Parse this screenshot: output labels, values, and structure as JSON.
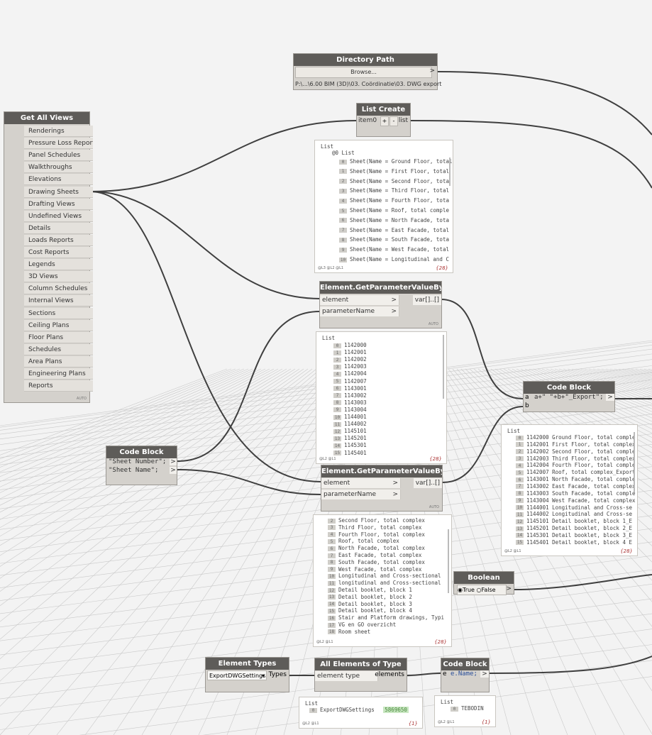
{
  "directory_path": {
    "title": "Directory Path",
    "browse_label": "Browse...",
    "path_value": "P:\\...\\6.00 BIM (3D)\\03. Coördinatie\\03. DWG export"
  },
  "get_all_views": {
    "title": "Get All Views",
    "auto": "AUTO",
    "items": [
      "Renderings",
      "Pressure Loss Reports",
      "Panel Schedules",
      "Walkthroughs",
      "Elevations",
      "Drawing Sheets",
      "Drafting Views",
      "Undefined Views",
      "Details",
      "Loads Reports",
      "Cost Reports",
      "Legends",
      "3D Views",
      "Column Schedules",
      "Internal Views",
      "Sections",
      "Ceiling Plans",
      "Floor Plans",
      "Schedules",
      "Area Plans",
      "Engineering Plans",
      "Reports"
    ]
  },
  "list_create": {
    "title": "List Create",
    "input_label": "item0",
    "plus": "+",
    "minus": "-",
    "output_label": "list",
    "preview": {
      "title": "List",
      "subtitle": "@0 List",
      "rows": [
        {
          "i": "0",
          "t": "Sheet(Name = Ground Floor, total"
        },
        {
          "i": "1",
          "t": "Sheet(Name = First Floor, total"
        },
        {
          "i": "2",
          "t": "Sheet(Name = Second Floor, tota"
        },
        {
          "i": "3",
          "t": "Sheet(Name = Third Floor, total"
        },
        {
          "i": "4",
          "t": "Sheet(Name = Fourth Floor, tota"
        },
        {
          "i": "5",
          "t": "Sheet(Name = Roof, total comple"
        },
        {
          "i": "6",
          "t": "Sheet(Name = North Facade, tota"
        },
        {
          "i": "7",
          "t": "Sheet(Name = East Facade, total"
        },
        {
          "i": "8",
          "t": "Sheet(Name = South Facade, tota"
        },
        {
          "i": "9",
          "t": "Sheet(Name = West Facade, total"
        },
        {
          "i": "10",
          "t": "Sheet(Name = Longitudinal and C"
        }
      ],
      "footer": "@L3 @L2 @L1",
      "count": "{28}"
    }
  },
  "get_param_1": {
    "title": "Element.GetParameterValueByName",
    "in1": "element",
    "in2": "parameterName",
    "out": "var[]..[]",
    "auto": "AUTO",
    "preview": {
      "title": "List",
      "rows": [
        {
          "i": "0",
          "t": "1142000"
        },
        {
          "i": "1",
          "t": "1142001"
        },
        {
          "i": "2",
          "t": "1142002"
        },
        {
          "i": "3",
          "t": "1142003"
        },
        {
          "i": "4",
          "t": "1142004"
        },
        {
          "i": "5",
          "t": "1142007"
        },
        {
          "i": "6",
          "t": "1143001"
        },
        {
          "i": "7",
          "t": "1143002"
        },
        {
          "i": "8",
          "t": "1143003"
        },
        {
          "i": "9",
          "t": "1143004"
        },
        {
          "i": "10",
          "t": "1144001"
        },
        {
          "i": "11",
          "t": "1144002"
        },
        {
          "i": "12",
          "t": "1145101"
        },
        {
          "i": "13",
          "t": "1145201"
        },
        {
          "i": "14",
          "t": "1145301"
        },
        {
          "i": "15",
          "t": "1145401"
        }
      ],
      "footer": "@L2 @L1",
      "count": "{28}"
    }
  },
  "get_param_2": {
    "title": "Element.GetParameterValueByName",
    "in1": "element",
    "in2": "parameterName",
    "out": "var[]..[]",
    "auto": "AUTO",
    "preview": {
      "rows": [
        {
          "i": "2",
          "t": "Second Floor, total complex"
        },
        {
          "i": "3",
          "t": "Third Floor, total complex"
        },
        {
          "i": "4",
          "t": "Fourth Floor, total complex"
        },
        {
          "i": "5",
          "t": "Roof, total complex"
        },
        {
          "i": "6",
          "t": "North Facade, total complex"
        },
        {
          "i": "7",
          "t": "East Facade, total complex"
        },
        {
          "i": "8",
          "t": "South Facade, total complex"
        },
        {
          "i": "9",
          "t": "West Facade, total complex"
        },
        {
          "i": "10",
          "t": "Longitudinal and Cross-sectional"
        },
        {
          "i": "11",
          "t": "longitudinal and Cross-sectional"
        },
        {
          "i": "12",
          "t": "Detail booklet, block 1"
        },
        {
          "i": "13",
          "t": "Detail booklet, block 2"
        },
        {
          "i": "14",
          "t": "Detail booklet, block 3"
        },
        {
          "i": "15",
          "t": "Detail booklet, block 4"
        },
        {
          "i": "16",
          "t": "Stair and Platform drawings, Typi"
        },
        {
          "i": "17",
          "t": "VG en GO overzicht"
        },
        {
          "i": "18",
          "t": "Room sheet"
        }
      ],
      "footer": "@L2 @L1",
      "count": "{28}"
    }
  },
  "code_block_left": {
    "title": "Code Block",
    "line1": "\"Sheet Number\";",
    "line2": "\"Sheet Name\";",
    "out": ">"
  },
  "code_block_right": {
    "title": "Code Block",
    "in_a": "a",
    "in_b": "b",
    "code": "a+\" \"+b+\"_Export\";",
    "out": ">",
    "preview": {
      "title": "List",
      "rows": [
        {
          "i": "0",
          "t": "1142000 Ground Floor, total comple"
        },
        {
          "i": "1",
          "t": "1142001 First Floor, total complex"
        },
        {
          "i": "2",
          "t": "1142002 Second Floor, total comple"
        },
        {
          "i": "3",
          "t": "1142003 Third Floor, total complex"
        },
        {
          "i": "4",
          "t": "1142004 Fourth Floor, total comple"
        },
        {
          "i": "5",
          "t": "1142007 Roof, total complex_Export"
        },
        {
          "i": "6",
          "t": "1143001 North Facade, total comple"
        },
        {
          "i": "7",
          "t": "1143002 East Facade, total complex"
        },
        {
          "i": "8",
          "t": "1143003 South Facade, total comple"
        },
        {
          "i": "9",
          "t": "1143004 West Facade, total complex"
        },
        {
          "i": "10",
          "t": "1144001 Longitudinal and Cross-se"
        },
        {
          "i": "11",
          "t": "1144002 Longitudinal and Cross-se"
        },
        {
          "i": "12",
          "t": "1145101 Detail booklet, block 1_E"
        },
        {
          "i": "13",
          "t": "1145201 Detail booklet, block 2_E"
        },
        {
          "i": "14",
          "t": "1145301 Detail booklet, block 3_E"
        },
        {
          "i": "15",
          "t": "1145401 Detail booklet, block 4 E"
        }
      ],
      "footer": "@L2 @L1",
      "count": "{28}"
    }
  },
  "boolean": {
    "title": "Boolean",
    "true_label": "True",
    "false_label": "False",
    "out": ">"
  },
  "element_types": {
    "title": "Element Types",
    "selected": "ExportDWGSettings",
    "out": "Types"
  },
  "all_elements": {
    "title": "All Elements of Type",
    "in": "element type",
    "out": "elements",
    "preview": {
      "title": "List",
      "row_index": "0",
      "row_text": "ExportDWGSettings",
      "row_id": "5869650",
      "footer": "@L2 @L1",
      "count": "{1}"
    }
  },
  "code_block_name": {
    "title": "Code Block",
    "in": "e",
    "code": "e.Name;",
    "out": ">",
    "preview": {
      "title": "List",
      "row_index": "0",
      "row_text": "TEBODIN",
      "footer": "@L2 @L1",
      "count": "{1}"
    }
  },
  "colors": {
    "header": "#5e5c59",
    "node_body": "#d4d1cc",
    "wire": "#3f3f3f",
    "grid_line": "#c9c9c9",
    "highlight": "#c9e7c2"
  }
}
